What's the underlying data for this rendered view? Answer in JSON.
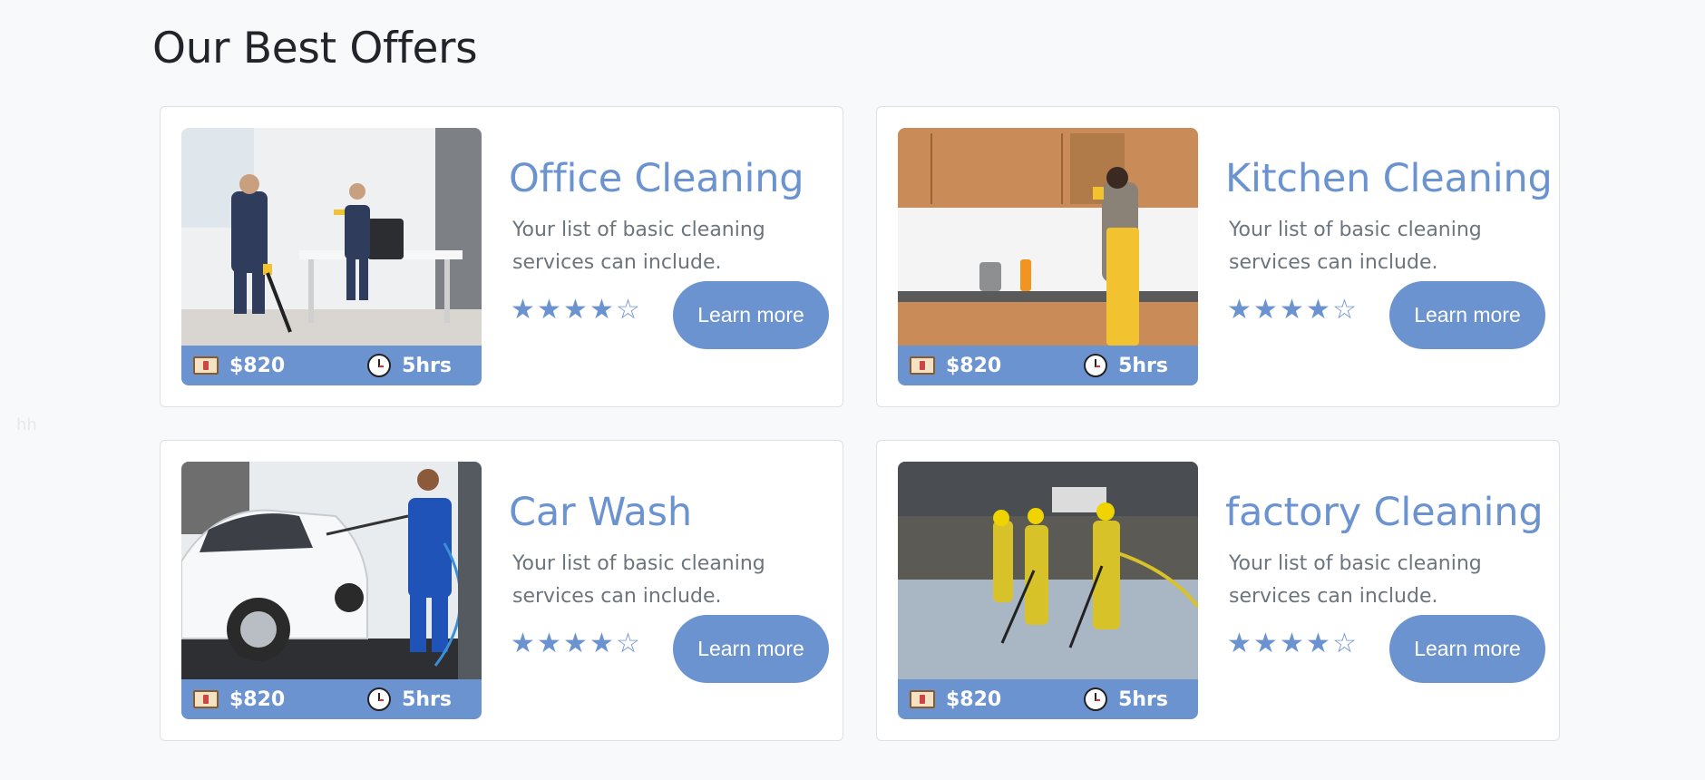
{
  "section": {
    "title": "Our Best Offers"
  },
  "stray_text": "hh",
  "offers": [
    {
      "title": "Office Cleaning",
      "description": "Your list of basic cleaning services can include.",
      "price": "$820",
      "duration": "5hrs",
      "rating": 4.5,
      "cta_label": "Learn more",
      "image": "office-cleaning-photo"
    },
    {
      "title": "Kitchen Cleaning",
      "description": "Your list of basic cleaning services can include.",
      "price": "$820",
      "duration": "5hrs",
      "rating": 4.5,
      "cta_label": "Learn more",
      "image": "kitchen-cleaning-photo"
    },
    {
      "title": "Car Wash",
      "description": "Your list of basic cleaning services can include.",
      "price": "$820",
      "duration": "5hrs",
      "rating": 4.5,
      "cta_label": "Learn more",
      "image": "car-wash-photo"
    },
    {
      "title": "factory Cleaning",
      "description": "Your list of basic cleaning services can include.",
      "price": "$820",
      "duration": "5hrs",
      "rating": 4.5,
      "cta_label": "Learn more",
      "image": "factory-cleaning-photo"
    }
  ],
  "icons": {
    "price": "money-icon",
    "duration": "clock-icon",
    "rating_full": "star-icon",
    "rating_empty": "star-outline-icon"
  },
  "colors": {
    "accent": "#6b93d0",
    "text": "#212529",
    "muted": "#6c757d",
    "background": "#f8f9fa"
  }
}
